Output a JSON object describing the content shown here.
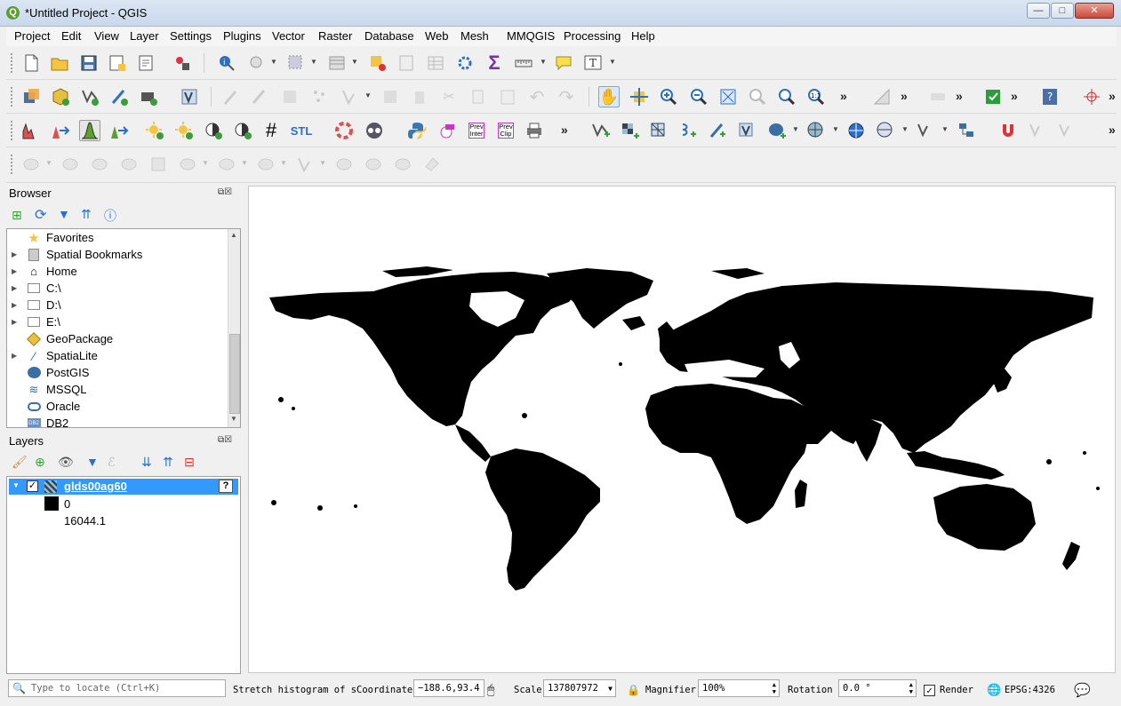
{
  "window": {
    "title": "*Untitled Project - QGIS",
    "logo": "Q"
  },
  "menu": [
    "Project",
    "Edit",
    "View",
    "Layer",
    "Settings",
    "Plugins",
    "Vector",
    "Raster",
    "Database",
    "Web",
    "Mesh",
    "MMQGIS",
    "Processing",
    "Help"
  ],
  "toolbar3": {
    "stl_label": "STL",
    "prev_inter_label": "Prev\nInter",
    "prev_clip_label": "Prev\nClip"
  },
  "browser": {
    "title": "Browser",
    "items": [
      {
        "label": "Favorites",
        "icon": "star-icon",
        "expandable": false
      },
      {
        "label": "Spatial Bookmarks",
        "icon": "bookmark-icon",
        "expandable": true
      },
      {
        "label": "Home",
        "icon": "home-folder-icon",
        "expandable": true
      },
      {
        "label": "C:\\",
        "icon": "folder-icon",
        "expandable": true
      },
      {
        "label": "D:\\",
        "icon": "folder-icon",
        "expandable": true
      },
      {
        "label": "E:\\",
        "icon": "folder-icon",
        "expandable": true
      },
      {
        "label": "GeoPackage",
        "icon": "geopackage-icon",
        "expandable": false
      },
      {
        "label": "SpatiaLite",
        "icon": "spatialite-icon",
        "expandable": true
      },
      {
        "label": "PostGIS",
        "icon": "postgis-elephant-icon",
        "expandable": false
      },
      {
        "label": "MSSQL",
        "icon": "mssql-icon",
        "expandable": false
      },
      {
        "label": "Oracle",
        "icon": "oracle-icon",
        "expandable": false
      },
      {
        "label": "DB2",
        "icon": "db2-icon",
        "expandable": false
      }
    ]
  },
  "layers": {
    "title": "Layers",
    "layer_name": "glds00ag60",
    "legend_min": "0",
    "legend_max": "16044.1",
    "help_glyph": "?"
  },
  "status": {
    "locate_placeholder": "Type to locate (Ctrl+K)",
    "message": "Stretch histogram of s",
    "coordinate_label": "Coordinate",
    "coordinate_value": "−188.6,93.4",
    "scale_label": "Scale",
    "scale_value": "137807972",
    "magnifier_label": "Magnifier",
    "magnifier_value": "100%",
    "rotation_label": "Rotation",
    "rotation_value": "0.0 °",
    "render_label": "Render",
    "crs": "EPSG:4326"
  },
  "colors": {
    "accent_blue": "#3399ff",
    "selected_layer": "#3399ff",
    "land": "#000000",
    "water": "#ffffff"
  }
}
